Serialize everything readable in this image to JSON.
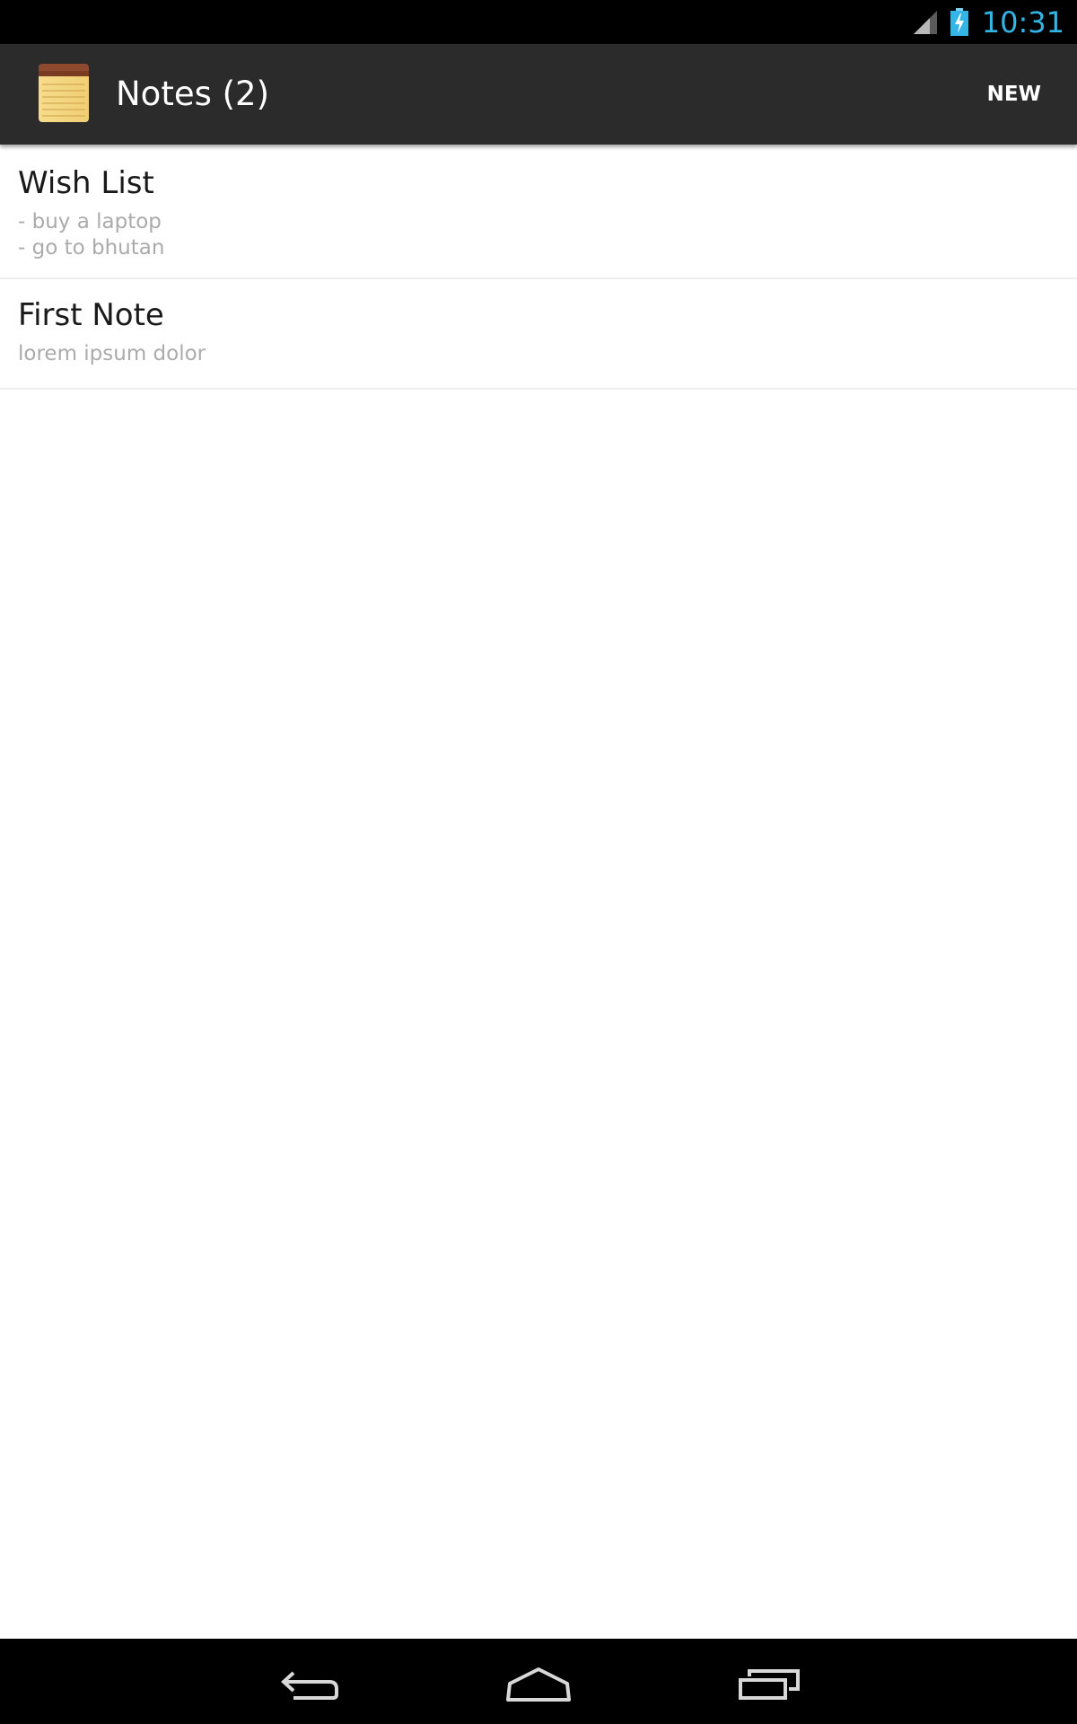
{
  "status_bar": {
    "time": "10:31",
    "time_color": "#33b5e5",
    "icons": [
      "signal-icon",
      "battery-charging-icon"
    ]
  },
  "action_bar": {
    "app_icon": "notepad-icon",
    "title": "Notes (2)",
    "new_label": "NEW",
    "background": "#2b2b2b"
  },
  "notes": [
    {
      "title": "Wish List",
      "preview": "- buy a laptop\n- go to bhutan"
    },
    {
      "title": "First Note",
      "preview": "lorem ipsum dolor"
    }
  ],
  "nav_bar": {
    "icons": [
      "back-icon",
      "home-icon",
      "recent-apps-icon"
    ]
  }
}
